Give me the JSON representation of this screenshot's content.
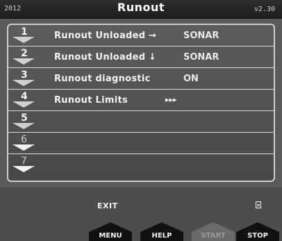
{
  "header": {
    "year": "2012",
    "title": "Runout",
    "version": "v2.30"
  },
  "menu": {
    "items": [
      {
        "number": "1",
        "label": "Runout Unloaded →",
        "value": "SONAR"
      },
      {
        "number": "2",
        "label": "Runout Unloaded ↓",
        "value": "SONAR"
      },
      {
        "number": "3",
        "label": "Runout diagnostic",
        "value": "ON"
      },
      {
        "number": "4",
        "label": "Runout Limits",
        "arrows": "▸▸▸"
      },
      {
        "number": "5"
      },
      {
        "number": "6"
      },
      {
        "number": "7"
      }
    ]
  },
  "footer": {
    "exit_label": "EXIT",
    "buttons": {
      "menu": "MENU",
      "help": "HELP",
      "start": "START",
      "stop": "STOP"
    }
  }
}
